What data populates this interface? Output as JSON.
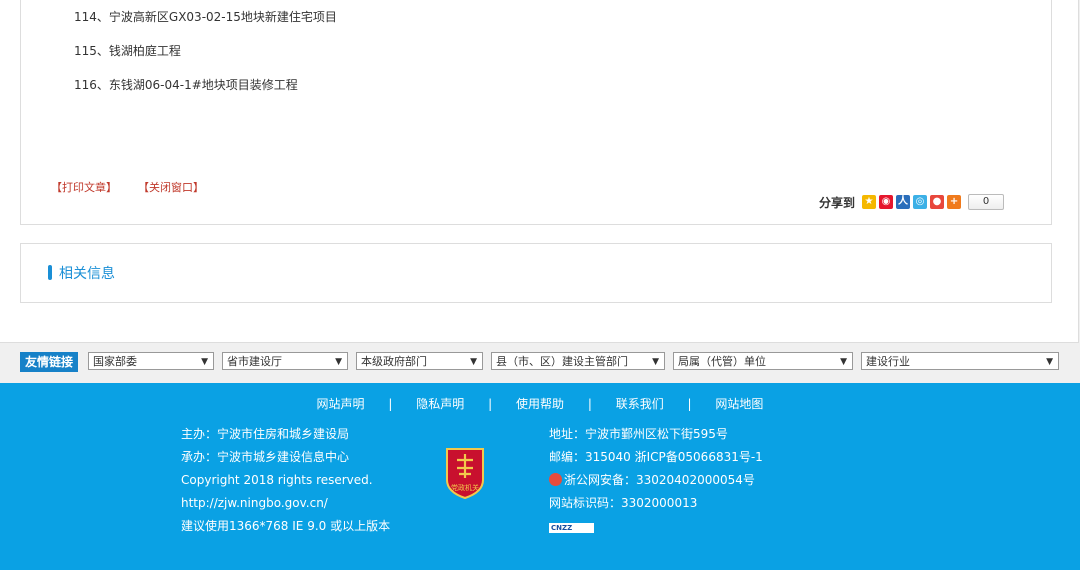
{
  "article": {
    "items": [
      "114、宁波高新区GX03-02-15地块新建住宅项目",
      "115、钱湖柏庭工程",
      "116、东钱湖06-04-1#地块项目装修工程"
    ],
    "print_label": "【打印文章】",
    "close_label": "【关闭窗口】"
  },
  "share": {
    "label": "分享到",
    "count": "0",
    "icons": [
      "qzone-icon",
      "weibo-icon",
      "renren-icon",
      "tencent-weibo-icon",
      "baidu-icon",
      "more-icon"
    ]
  },
  "related": {
    "title": "相关信息"
  },
  "links": {
    "label": "友情链接",
    "selects": [
      "国家部委",
      "省市建设厅",
      "本级政府部门",
      "县（市、区）建设主管部门",
      "局属（代管）单位",
      "建设行业"
    ]
  },
  "footer": {
    "nav": [
      "网站声明",
      "隐私声明",
      "使用帮助",
      "联系我们",
      "网站地图"
    ],
    "left": [
      "主办：宁波市住房和城乡建设局",
      "承办：宁波市城乡建设信息中心",
      "Copyright 2018 rights reserved.",
      "http://zjw.ningbo.gov.cn/",
      "建议使用1366*768 IE 9.0 或以上版本"
    ],
    "address": "地址：宁波市鄞州区松下街595号",
    "postcode": "邮编：315040 浙ICP备05066831号-1",
    "police": "浙公网安备：33020402000054号",
    "site_id": "网站标识码：3302000013",
    "badge_text": "党政机关",
    "cnzz": "CNZZ"
  },
  "colors": {
    "accent": "#1a8fd6",
    "footer_bg": "#0aa1e4",
    "link_red": "#c0392b"
  }
}
